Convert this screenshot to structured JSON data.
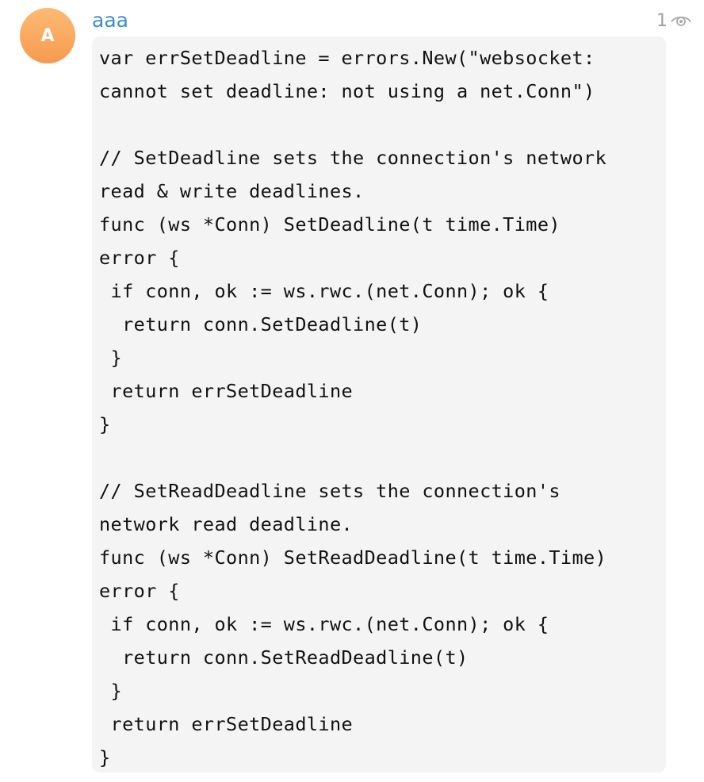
{
  "avatar": {
    "initial": "A",
    "color_top": "#fcbb73",
    "color_bottom": "#f69a4f"
  },
  "sender": {
    "name": "aaa",
    "color": "#3a8dd0"
  },
  "views": {
    "count": "1",
    "icon": "eye-icon"
  },
  "message": {
    "code": "var errSetDeadline = errors.New(\"websocket:\ncannot set deadline: not using a net.Conn\")\n\n// SetDeadline sets the connection's network\nread & write deadlines.\nfunc (ws *Conn) SetDeadline(t time.Time)\nerror {\n if conn, ok := ws.rwc.(net.Conn); ok {\n  return conn.SetDeadline(t)\n }\n return errSetDeadline\n}\n\n// SetReadDeadline sets the connection's\nnetwork read deadline.\nfunc (ws *Conn) SetReadDeadline(t time.Time)\nerror {\n if conn, ok := ws.rwc.(net.Conn); ok {\n  return conn.SetReadDeadline(t)\n }\n return errSetDeadline\n}"
  }
}
